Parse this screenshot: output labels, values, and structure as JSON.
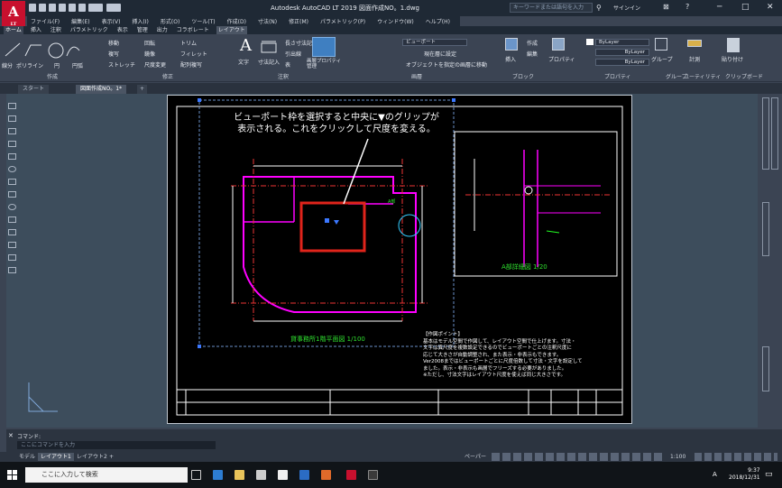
{
  "app": {
    "logo": "A",
    "logo_sub": "LT",
    "title": "Autodesk AutoCAD LT 2019    図面作成NO。1.dwg"
  },
  "titlebar": {
    "search_placeholder": "キーワードまたは語句を入力",
    "signin": "サインイン"
  },
  "menu": [
    "ファイル(F)",
    "編集(E)",
    "表示(V)",
    "挿入(I)",
    "形式(O)",
    "ツール(T)",
    "作成(D)",
    "寸法(N)",
    "修正(M)",
    "パラメトリック(P)",
    "ウィンドウ(W)",
    "ヘルプ(H)"
  ],
  "ribbon_tabs": [
    "ホーム",
    "挿入",
    "注釈",
    "パラメトリック",
    "表示",
    "管理",
    "出力",
    "コラボレート",
    "レイアウト"
  ],
  "ribbon": {
    "draw": {
      "title": "作成",
      "line": "線分",
      "polyline": "ポリライン",
      "circle": "円",
      "arc": "円弧"
    },
    "modify": {
      "title": "修正",
      "move": "移動",
      "rotate": "回転",
      "trim": "トリム",
      "copy": "複写",
      "mirror": "鏡像",
      "fillet": "フィレット",
      "stretch": "ストレッチ",
      "scale": "尺度変更",
      "array": "配列複写"
    },
    "annotation": {
      "title": "注釈",
      "text": "文字",
      "dimension": "寸法記入",
      "linear": "長さ寸法記入",
      "leader": "引出線",
      "table": "表"
    },
    "layers": {
      "title": "画層",
      "layer_props": "画層プロパティ管理",
      "current_layer": "ビューポート",
      "make_current": "現在層に設定",
      "match": "オブジェクトを指定の画層に移動"
    },
    "block": {
      "title": "ブロック",
      "insert": "挿入",
      "create": "作成",
      "edit": "編集"
    },
    "properties": {
      "title": "プロパティ",
      "match": "プロパティ",
      "bylayer1": "ByLayer",
      "bylayer2": "ByLayer",
      "bylayer3": "ByLayer"
    },
    "groups": {
      "title": "グループ",
      "label": "グループ"
    },
    "utilities": {
      "title": "ユーティリティ",
      "measure": "計測"
    },
    "clipboard": {
      "title": "クリップボード",
      "paste": "貼り付け"
    }
  },
  "doc_tabs": [
    "スタート",
    "図面作成NO。1*"
  ],
  "drawing": {
    "callout": "ビューポート枠を選択すると中央に▼のグリップが表示される。これをクリックして尺度を変える。",
    "plan_title": "貸事務所1階平面図  1/100",
    "detail_title": "A部詳細図  1/20",
    "detail_label": "A部",
    "notes_title": "【作図ポイント】",
    "notes": [
      "基本はモデル空間で作図して、レイアウト空間で仕上げます。寸法・",
      "文字は異尺度を複数設定できるのでビューポートごとの注釈尺度に",
      "応じて大きさが自動調整され、また表示・非表示もできます。",
      "Ver2008まではビューポートごとに尺度倍数して寸法・文字を設定して",
      "ました。表示・非表示も画層でフリーズする必要がありました。",
      "※ただし、寸法文字はレイアウト尺度を使えば同じ大きさです。"
    ]
  },
  "command": {
    "label": "コマンド:",
    "placeholder": "ここにコマンドを入力"
  },
  "status_tabs": [
    "モデル",
    "レイアウト1",
    "レイアウト2"
  ],
  "status": {
    "paper": "ペーパー",
    "scale": "1:100"
  },
  "taskbar": {
    "search": "ここに入力して検索",
    "time": "9:37",
    "date": "2018/12/31",
    "ime": "A"
  },
  "colors": {
    "accent_red": "#e0241b",
    "autocad_red": "#c8102e",
    "ribbon_bg": "#3b4453",
    "paper_bg": "#000000"
  }
}
